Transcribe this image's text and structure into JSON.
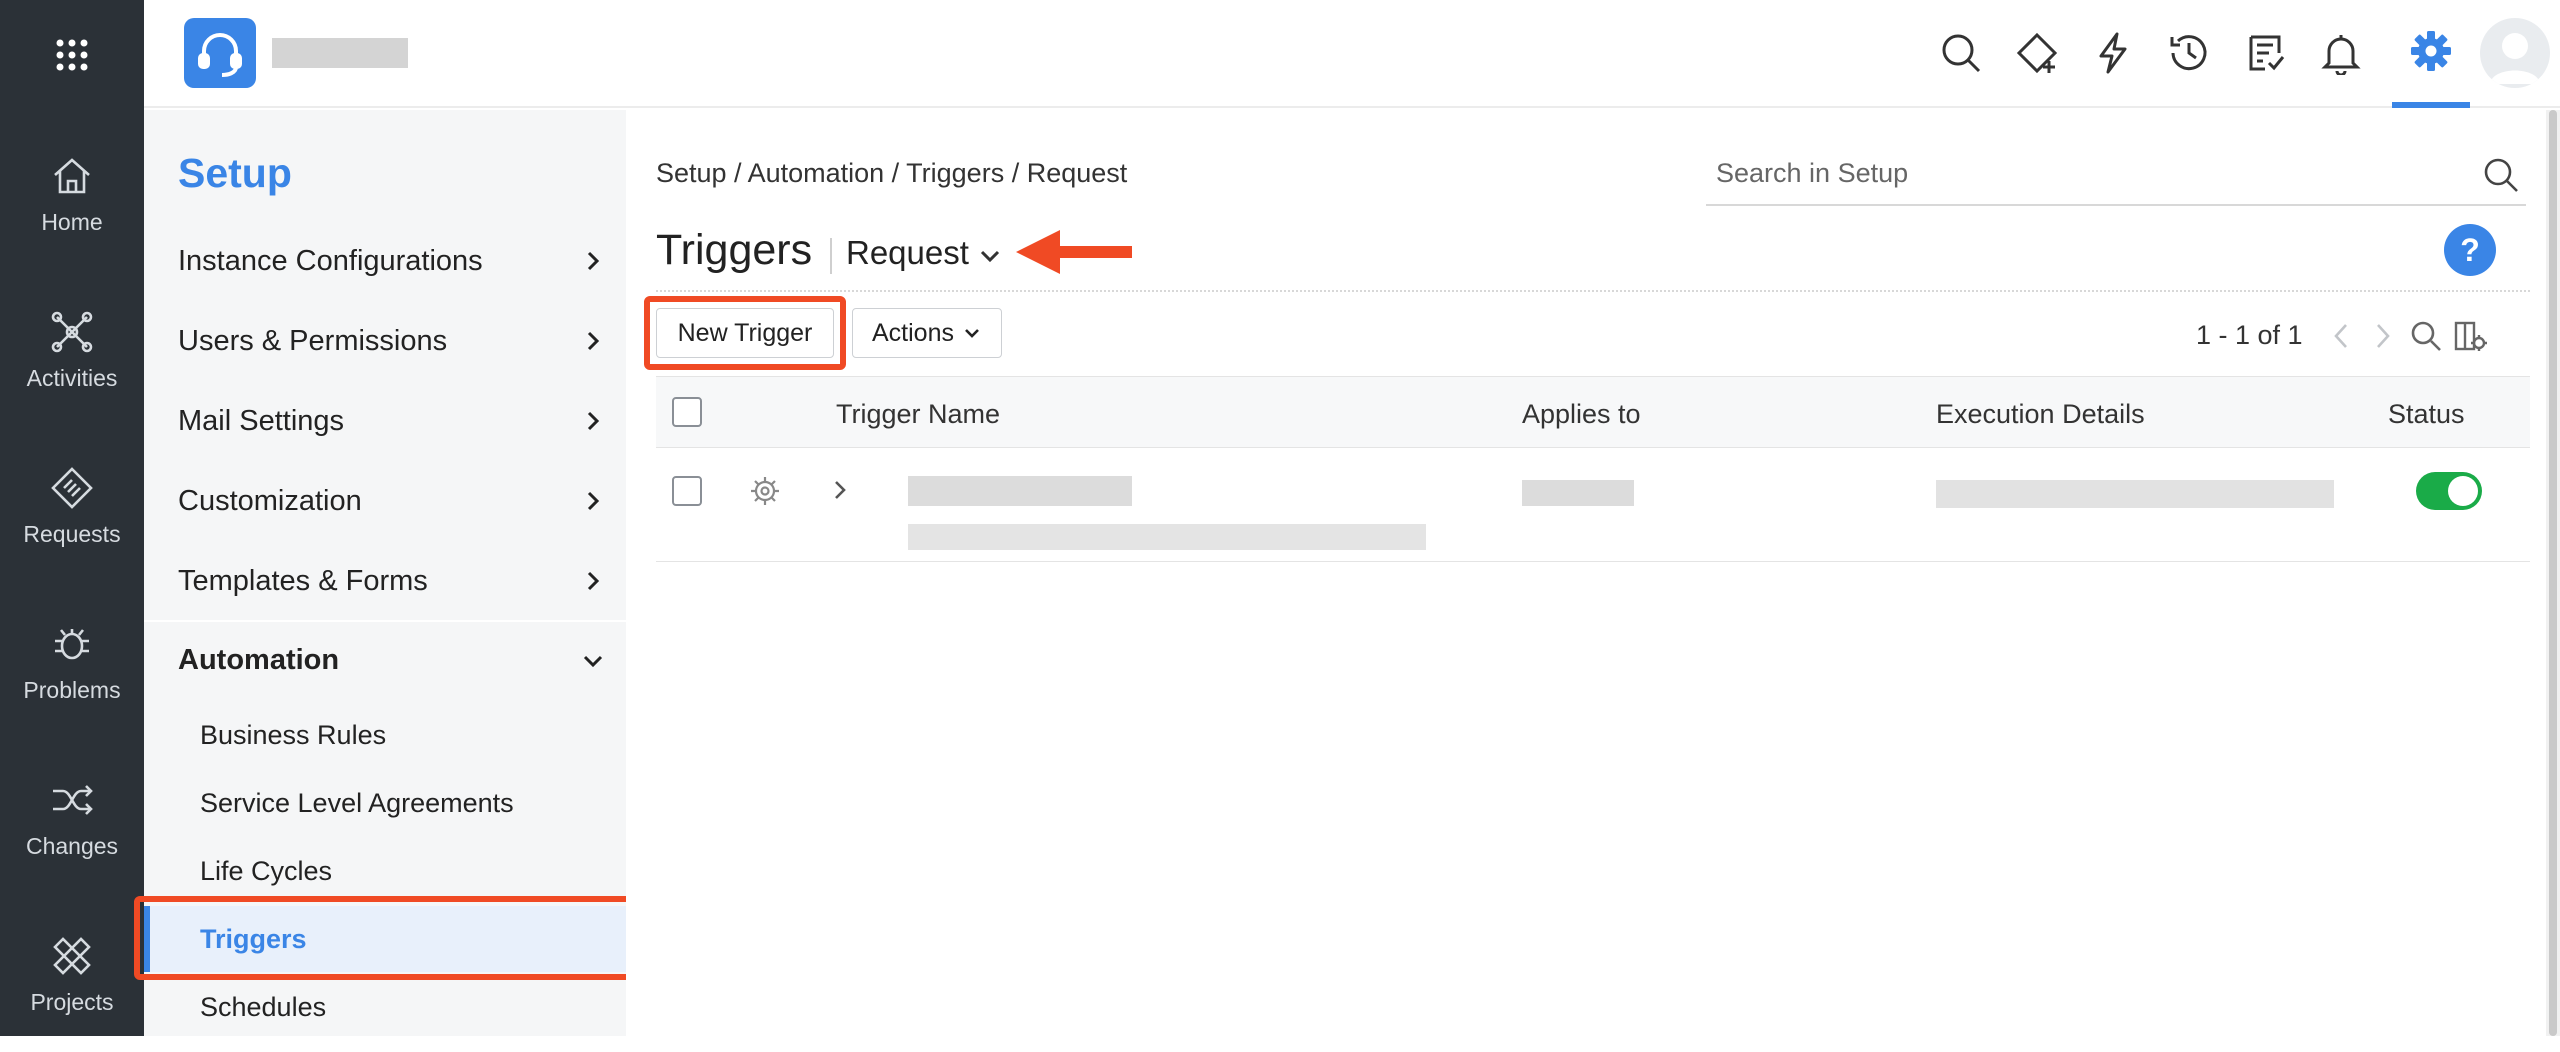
{
  "rail": {
    "items": [
      {
        "label": "Home",
        "icon": "home-icon"
      },
      {
        "label": "Activities",
        "icon": "activities-icon"
      },
      {
        "label": "Requests",
        "icon": "requests-icon"
      },
      {
        "label": "Problems",
        "icon": "problems-icon"
      },
      {
        "label": "Changes",
        "icon": "changes-icon"
      },
      {
        "label": "Projects",
        "icon": "projects-icon"
      }
    ]
  },
  "header": {
    "icons": [
      "search-icon",
      "new-ticket-icon",
      "quick-actions-icon",
      "history-icon",
      "tasks-icon",
      "notifications-icon",
      "settings-icon",
      "user-avatar"
    ],
    "accent": "#3a85e6"
  },
  "setup": {
    "title": "Setup",
    "menu": [
      {
        "label": "Instance Configurations"
      },
      {
        "label": "Users & Permissions"
      },
      {
        "label": "Mail Settings"
      },
      {
        "label": "Customization"
      },
      {
        "label": "Templates & Forms"
      },
      {
        "label": "Automation"
      }
    ],
    "automation_items": [
      {
        "label": "Business Rules"
      },
      {
        "label": "Service Level Agreements"
      },
      {
        "label": "Life Cycles"
      },
      {
        "label": "Triggers"
      },
      {
        "label": "Schedules"
      }
    ]
  },
  "main": {
    "breadcrumb": "Setup / Automation / Triggers / Request",
    "search_placeholder": "Search in Setup",
    "title": "Triggers",
    "module": "Request",
    "help": "?",
    "new_button": "New Trigger",
    "actions_button": "Actions",
    "pager": "1 - 1 of 1",
    "columns": [
      "Trigger Name",
      "Applies to",
      "Execution Details",
      "Status"
    ],
    "row": {
      "status_enabled": true
    }
  },
  "colors": {
    "highlight": "#f04a24",
    "toggle_on": "#1aab48",
    "rail_bg": "#2b3137"
  }
}
